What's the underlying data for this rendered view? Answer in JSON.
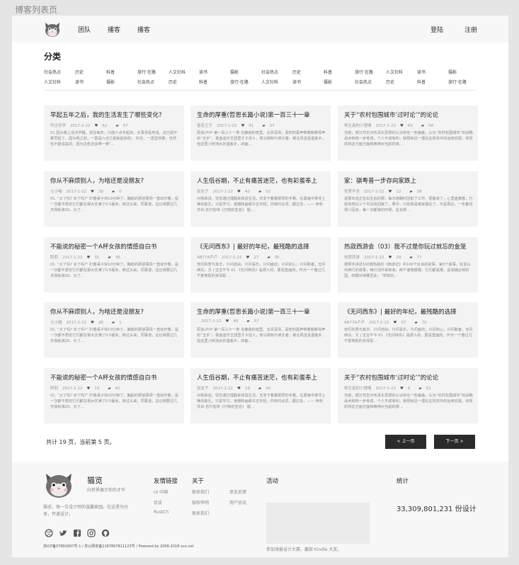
{
  "page_label": "博客列表页",
  "header": {
    "nav": [
      "团队",
      "播客",
      "播客"
    ],
    "login": "登陆",
    "register": "注册"
  },
  "category": {
    "title": "分类",
    "row1": [
      "社会热点",
      "历史",
      "科普",
      "旅行·在路",
      "人文社科",
      "读书",
      "摄影",
      "社会热点",
      "历史",
      "科普",
      "旅行·在路",
      "人文社科",
      "读书",
      "摄影"
    ],
    "row2": [
      "人文社科",
      "读书",
      "摄影",
      "社会热点",
      "历史",
      "科普",
      "旅行·在路",
      "人文社科",
      "读书",
      "摄影",
      "社会热点",
      "历史",
      "科普",
      "旅行·在路"
    ]
  },
  "cards": [
    {
      "title": "早起五年之后，我的生活发生了哪些变化?",
      "author": "咋见初学",
      "date": "2017-1-22",
      "likes": "62",
      "comments": "57",
      "excerpt": "01 因为晚上没法学睡。现在每天，只能六点半起床。买事求是地说。这已经不算早起了，因为我之前，一直是六点之前就起床的。 好在，一直坚持着，当然也不能说是的，因为这些还会带一种“..."
    },
    {
      "title": "生命的厚重(哲思长篇小说)第一百三十一章",
      "author": "香茗王子",
      "date": "2017-1-22",
      "likes": "41",
      "comments": "37",
      "excerpt": "原创/卢卢 第一百三十一章 在静寂的夜里。北风凛冽，喜旺的黑声带着嘶嘶琴声的“玉手”，挑鱼音乐王团里才子佳人，苟马相知与卓文者，被北风送进温客乡，但这里小桥流水的温客乡，四面..."
    },
    {
      "title": "关于“农村包围城市‘过时论’”的论论",
      "author": "再生者的小馒嗓",
      "date": "2017-1-22",
      "likes": "69",
      "comments": "58",
      "excerpt": "当前，部分司志对毛泽东思想的认识存在一些偏差。认为“农村包围城市”的战略战术和统一步考虑，个人不成有利，我想就这一理论在现实中的运用实践，体现的将这方面方面和精神对当前的感..."
    },
    {
      "title": "你从不麻烦别人，为啥还是没朋友?",
      "author": "七小喵",
      "date": "2017-1-22",
      "likes": "28",
      "comments": "0",
      "excerpt": "01. “大了吗? 买了吗?” 盯着桌子快10分钟了。胸前的那道事情一直动作着，是一次都不想定它们都在相大饮满了0.5毫米。转过头来，同事道，这记得要过几天我就演20，为了..."
    },
    {
      "title": "人生低谷期，不止有痛苦迷茫，也有彩蛋奉上",
      "author": "张女子",
      "date": "2017-1-22",
      "likes": "42",
      "comments": "52",
      "excerpt": "对我来说，饮饮通过理髓来体验生活，无非于看看那厚的手看，在黑暗中搜寻上等的能孔，只是学习，诡期和画或许正年轻。你有时必须...跟过去，—— 伊莉莎白·吉尔伯特《万物的签名》 题..."
    },
    {
      "title": "家：骐粤普一步存向家跌上",
      "author": "张里不坐",
      "date": "2017-1-22",
      "likes": "12",
      "comments": "38",
      "excerpt": "说那年说正位出生后的那，每次通路时回前了工作，便搬家了，心里盘算着，已经有将近三个月没有回家了，果中，只有我是离家最近了，可是再近，一年都也很少回去，每一次都家的时候，总会想..."
    },
    {
      "title": "不能说的秘密一个A杯女孩的情感自白书",
      "author": "阿莉",
      "date": "2017-1-22",
      "likes": "31",
      "comments": "36",
      "excerpt": "01. “大了吗? 买了吗?” 盯着桌子快10分钟了。胸前的那道事情一直动作着，是一次都不想定它们都在相大饮满了0.5毫米。转过头来，同事道，这记得要过几天我就演20，为了..."
    },
    {
      "title": "《无问西东》| 最好的年纪，最残酷的选择",
      "author": "AB774卢卢",
      "date": "2017-1-22",
      "likes": "27",
      "comments": "35",
      "excerpt": "他们的爱与其华，只问自由，只问喜乐，只问盛欣；只问初心；只问敢者，无问西东。文 | 宝宝不今 01 《无问西东》是很人的，更是直面的。作为一个看过几千部电影的资深影..."
    },
    {
      "title": "热寂西游会（03）我不过是你玩过就忘的金笼",
      "author": "热寂西游",
      "date": "2017-1-22",
      "likes": "29",
      "comments": "77",
      "excerpt": "按照手讲述100篇热寂的《西游记》中100个反派的故事，第3个故事，狂蛮山内西行的道事，两只活坏来到家，两个谨慎猴猴，它们都是猴，是来捕必将的国。四猴对待猴至此，“常较的..."
    },
    {
      "title": "你从不麻烦别人，为啥还是没朋友?",
      "author": "七小喵",
      "date": "2017-1-22",
      "likes": "28",
      "comments": "1",
      "excerpt": "01. “大了吗? 买了吗?” 盯着桌子快10分钟了。胸前的那道事情一直动作着，是一次都不想定它们都在相大饮满了0.5毫米。转过头来，同事道，这记得要过几天我就演20，为了..."
    },
    {
      "title": "生命的厚重(哲思长篇小说)第一百三十一章",
      "author": "",
      "date": "2017-1-22",
      "likes": "48",
      "comments": "57",
      "excerpt": "原创/卢卢 第一百三十一章 在静寂的夜里。北风凛冽，喜旺的黑声带着嘶嘶琴声的“玉手”，挑鱼音乐王团里才子佳人，苟马相知与卓文者，被北风送进温客乡，但这里小桥流水的温客乡，四面..."
    },
    {
      "title": "《无问西东》| 最好的年纪，最残酷的选择",
      "author": "AB774卢卢",
      "date": "2017-1-22",
      "likes": "57",
      "comments": "70",
      "excerpt": "他们的爱与其华，只问自由，只问喜乐，只问盛欣；只问初心；只问敢者，无问西东。文 | 宝宝不今 01 《无问西东》是很人的，更是直面的。作为一个看过几千部电影的资深影..."
    },
    {
      "title": "不能说的秘密一个A杯女孩的情感自白书",
      "author": "阿莉",
      "date": "2017-1-22",
      "likes": "13",
      "comments": "41",
      "excerpt": "01. “大了吗? 买了吗?” 盯着桌子快10分钟了。胸前的那道事情一直动作着，是一次都不想定它们都在相大饮满了0.5毫米。转过头来，同事道，这记得要过几天我就演20，为了..."
    },
    {
      "title": "人生低谷期，不止有痛苦迷茫，也有彩蛋奉上",
      "author": "张女子",
      "date": "2017-1-22",
      "likes": "19",
      "comments": "30",
      "excerpt": "对我来说，饮饮通过理髓来体验生活，无非于看看那厚的手看，在黑暗中搜寻上等的能孔，只是学习，诡期和画或许正年轻。你有时必须...跟过去，—— 伊莉莎白·吉尔伯特《万物的签名》 题..."
    },
    {
      "title": "关于“农村包围城市‘过时论’”的论论",
      "author": "再生者的小馒嗓",
      "date": "2017-1-22",
      "likes": "6",
      "comments": "51",
      "excerpt": "当前，部分司志对毛泽东思想的认识存在一些偏差。认为“农村包围城市”的战略战术和统一步考虑，个人不成有利，我想就这一理论在现实中的运用实践，体现的将这方面方面和精神对当前的感..."
    }
  ],
  "pagination": {
    "info": "共计 19 页，当前第 5 页。",
    "prev": "< 上一页",
    "next": "下一页 >"
  },
  "footer": {
    "brand": "猫览",
    "slogan": "向世界展示你的才华",
    "about_text": "猫览，每一位设计师的温馨家园。在这里为分享，传递设计。",
    "friend_links_title": "友情链接",
    "friend_links": [
      "UI 中国",
      "优设",
      "RustCh"
    ],
    "about_title": "关于",
    "about_links_col1": [
      "联系我们",
      "版权申明",
      "联系我们"
    ],
    "about_links_col2": [
      "意见反馈",
      "用户协议"
    ],
    "activity_title": "活动",
    "activity_caption": "参加海报设计大赛，赢取 Kindle 大奖。",
    "stats_title": "统计",
    "stats_value": "33,309,801,231 份设计",
    "copyright": "苏ICP备07891897号-1 / 苏公网安备2187897811123号 / Powered by 2008-2018 xxx.net"
  },
  "icons": {
    "logo": "cat-logo-icon",
    "social": [
      "dribbble-icon",
      "twitter-icon",
      "facebook-icon",
      "instagram-icon",
      "github-icon"
    ]
  }
}
